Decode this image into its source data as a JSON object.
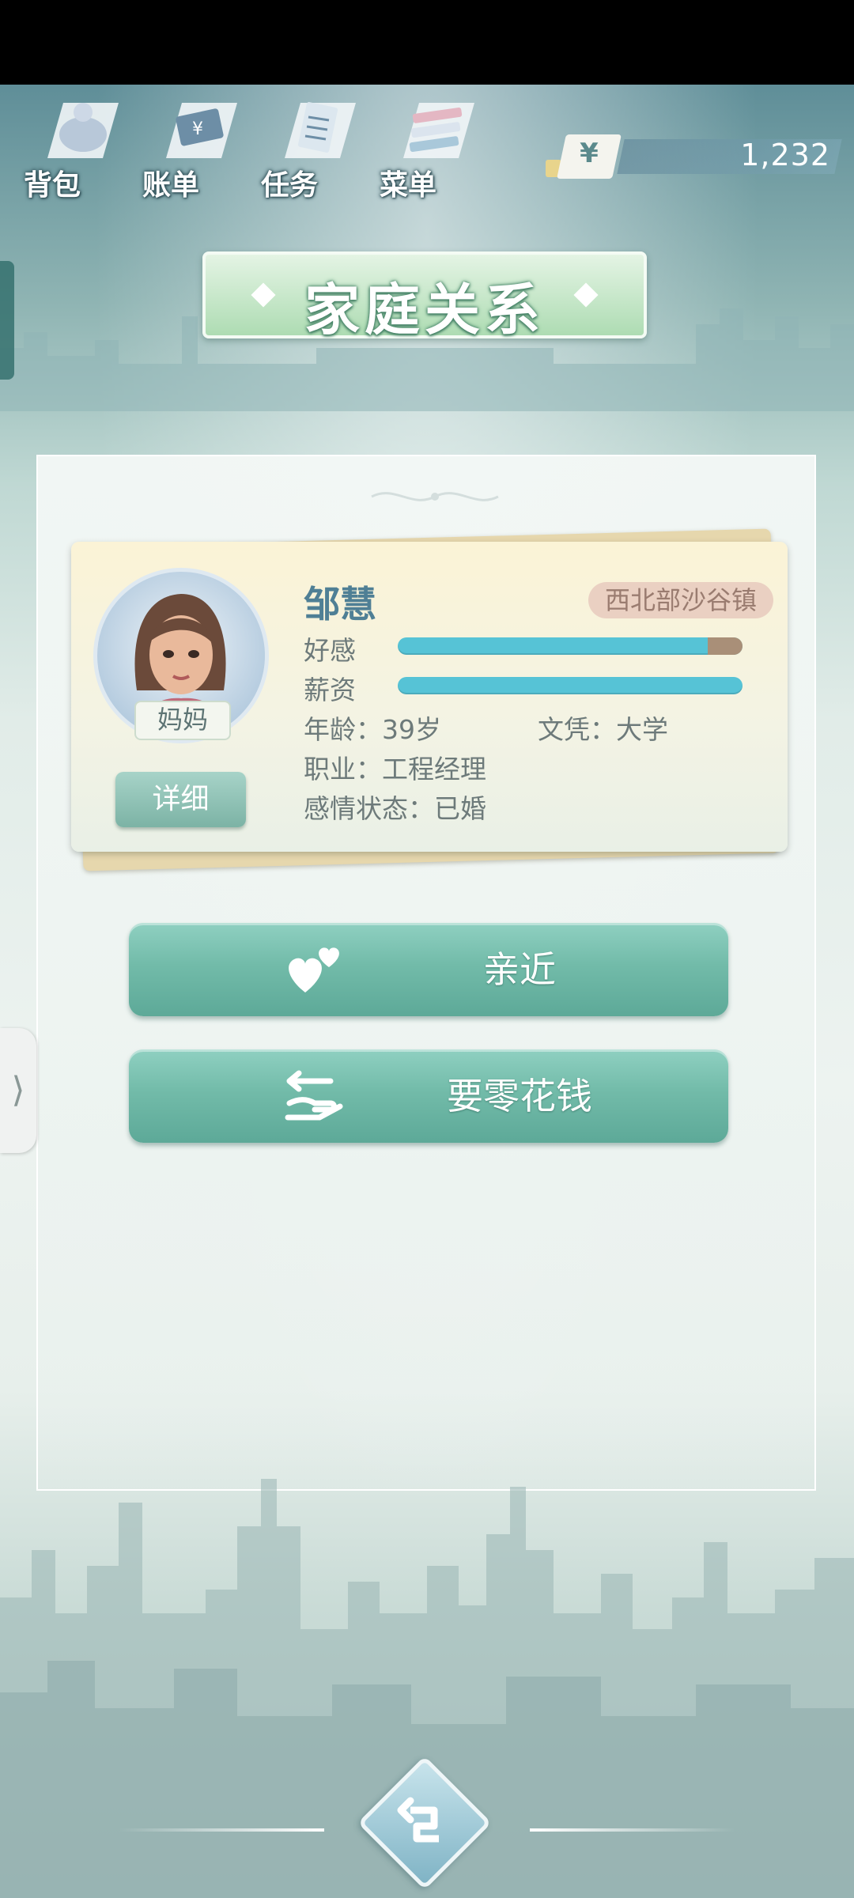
{
  "menu": {
    "items": [
      {
        "label": "背包",
        "icon": "bag-icon"
      },
      {
        "label": "账单",
        "icon": "bill-icon"
      },
      {
        "label": "任务",
        "icon": "task-icon"
      },
      {
        "label": "菜单",
        "icon": "menu-icon"
      }
    ]
  },
  "money": {
    "currency_symbol": "¥",
    "value": "1,232"
  },
  "page_title": "家庭关系",
  "member": {
    "name": "邹慧",
    "role": "妈妈",
    "region": "西北部沙谷镇",
    "affection_label": "好感",
    "affection_level": 0.9,
    "salary_label": "薪资",
    "salary_level": 1.0,
    "age": "年龄：39岁",
    "education": "文凭：大学",
    "occupation": "职业：工程经理",
    "relationship": "感情状态：已婚",
    "detail_button": "详细"
  },
  "actions": [
    {
      "label": "亲近",
      "icon": "hearts-icon"
    },
    {
      "label": "要零花钱",
      "icon": "exchange-hand-icon"
    }
  ],
  "colors": {
    "bar": "#56c3d6",
    "bar_rest": "#a98f78",
    "button": "#72bba9",
    "title_text": "#4f7f95"
  },
  "side_handle": "⟩"
}
